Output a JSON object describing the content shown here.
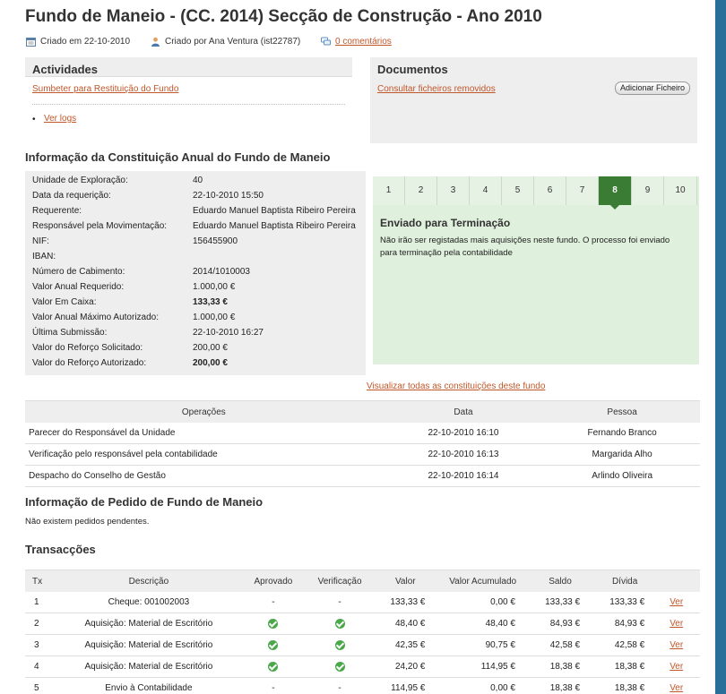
{
  "title": "Fundo de Maneio - (CC. 2014) Secção de Construção - Ano 2010",
  "meta": {
    "created_on": "Criado em 22-10-2010",
    "created_by": "Criado por Ana Ventura (ist22787)",
    "comments": "0 comentários"
  },
  "activities": {
    "title": "Actividades",
    "submit_link": "Sumbeter para Restituição do Fundo",
    "logs_link": "Ver logs"
  },
  "documents": {
    "title": "Documentos",
    "removed_link": "Consultar ficheiros removidos",
    "add_button": "Adicionar Ficheiro"
  },
  "constitution": {
    "title": "Informação da Constituição Anual do Fundo de Maneio",
    "rows": [
      {
        "label": "Unidade de Exploração:",
        "value": "40",
        "bold": false
      },
      {
        "label": "Data da requerição:",
        "value": "22-10-2010 15:50",
        "bold": false
      },
      {
        "label": "Requerente:",
        "value": "Eduardo Manuel Baptista Ribeiro Pereira",
        "bold": false
      },
      {
        "label": "Responsável pela Movimentação:",
        "value": "Eduardo Manuel Baptista Ribeiro Pereira",
        "bold": false
      },
      {
        "label": "NIF:",
        "value": "156455900",
        "bold": false
      },
      {
        "label": "IBAN:",
        "value": "",
        "bold": false
      },
      {
        "label": "Número de Cabimento:",
        "value": "2014/1010003",
        "bold": false
      },
      {
        "label": "Valor Anual Requerido:",
        "value": "1.000,00 €",
        "bold": false
      },
      {
        "label": "Valor Em Caixa:",
        "value": "133,33 €",
        "bold": true
      },
      {
        "label": "Valor Anual Máximo Autorizado:",
        "value": "1.000,00 €",
        "bold": false
      },
      {
        "label": "Última Submissão:",
        "value": "22-10-2010 16:27",
        "bold": false
      },
      {
        "label": "Valor do Reforço Solicitado:",
        "value": "200,00 €",
        "bold": false
      },
      {
        "label": "Valor do Reforço Autorizado:",
        "value": "200,00 €",
        "bold": true
      }
    ],
    "view_all_link": "Visualizar todas as constituições deste fundo"
  },
  "status": {
    "steps": [
      "1",
      "2",
      "3",
      "4",
      "5",
      "6",
      "7",
      "8",
      "9",
      "10"
    ],
    "active_step": "8",
    "title": "Enviado para Terminação",
    "text_line1": "Não irão ser registadas mais aquisições neste fundo. O processo foi enviado",
    "text_line2": "para terminação pela contabilidade",
    "color_active": "#3a7c33",
    "color_bg": "#dff0dc"
  },
  "operations": {
    "headers": [
      "Operações",
      "Data",
      "Pessoa"
    ],
    "rows": [
      [
        "Parecer do Responsável da Unidade",
        "22-10-2010 16:10",
        "Fernando Branco"
      ],
      [
        "Verificação pelo responsável pela contabilidade",
        "22-10-2010 16:13",
        "Margarida Alho"
      ],
      [
        "Despacho do Conselho de Gestão",
        "22-10-2010 16:14",
        "Arlindo Oliveira"
      ]
    ]
  },
  "request": {
    "title": "Informação de Pedido de Fundo de Maneio",
    "empty_text": "Não existem pedidos pendentes."
  },
  "transactions": {
    "title": "Transacções",
    "headers": [
      "Tx",
      "Descrição",
      "Aprovado",
      "Verificação",
      "Valor",
      "Valor Acumulado",
      "Saldo",
      "Dívida",
      ""
    ],
    "rows": [
      {
        "tx": "1",
        "desc": "Cheque: 001002003",
        "approved": "-",
        "verified": "-",
        "value": "133,33 €",
        "acc": "0,00 €",
        "balance": "133,33 €",
        "debt": "133,33 €",
        "link": "Ver"
      },
      {
        "tx": "2",
        "desc": "Aquisição: Material de Escritório",
        "approved": "check",
        "verified": "check",
        "value": "48,40 €",
        "acc": "48,40 €",
        "balance": "84,93 €",
        "debt": "84,93 €",
        "link": "Ver"
      },
      {
        "tx": "3",
        "desc": "Aquisição: Material de Escritório",
        "approved": "check",
        "verified": "check",
        "value": "42,35 €",
        "acc": "90,75 €",
        "balance": "42,58 €",
        "debt": "42,58 €",
        "link": "Ver"
      },
      {
        "tx": "4",
        "desc": "Aquisição: Material de Escritório",
        "approved": "check",
        "verified": "check",
        "value": "24,20 €",
        "acc": "114,95 €",
        "balance": "18,38 €",
        "debt": "18,38 €",
        "link": "Ver"
      },
      {
        "tx": "5",
        "desc": "Envio à Contabilidade",
        "approved": "-",
        "verified": "-",
        "value": "114,95 €",
        "acc": "0,00 €",
        "balance": "18,38 €",
        "debt": "18,38 €",
        "link": "Ver"
      }
    ]
  }
}
